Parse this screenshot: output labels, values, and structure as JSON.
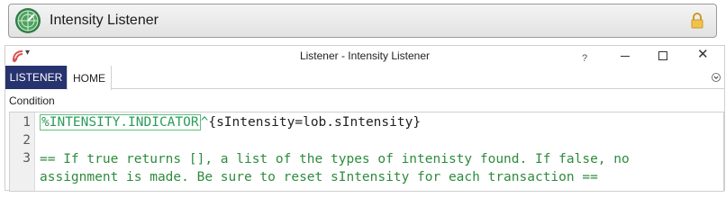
{
  "header": {
    "title": "Intensity Listener",
    "logo_icon": "radar-icon",
    "lock_icon": "lock-icon"
  },
  "window": {
    "title": "Listener - Intensity Listener",
    "help": "?",
    "minimize_icon": "minimize-icon",
    "maximize_icon": "maximize-icon",
    "close_glyph": "✕"
  },
  "ribbon": {
    "tabs": [
      {
        "label": "LISTENER",
        "active": false
      },
      {
        "label": "HOME",
        "active": true
      }
    ]
  },
  "condition": {
    "label": "Condition",
    "lines": [
      {
        "num": "1",
        "macro": "%INTENSITY.INDICATOR",
        "caret": "^",
        "rest": "{sIntensity=lob.sIntensity}"
      },
      {
        "num": "2",
        "text": ""
      },
      {
        "num": "3",
        "text": "== If true returns [], a list of the types of intenisty found. If false, no"
      },
      {
        "num": "",
        "text": "assignment is made. Be sure to reset sIntensity for each transaction =="
      }
    ]
  },
  "colors": {
    "tab_active_bg": "#26336e",
    "macro_green": "#2a9c5a",
    "comment_green": "#2e8b3d"
  }
}
